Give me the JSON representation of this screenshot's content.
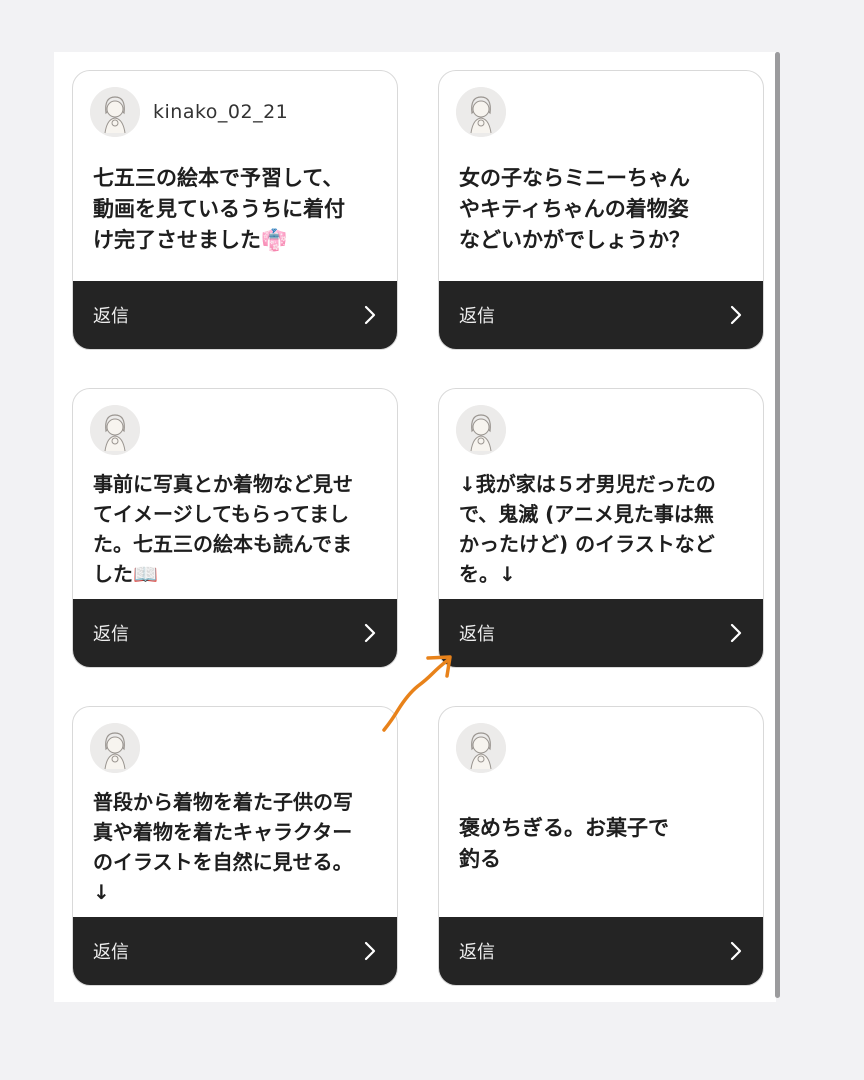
{
  "cards": [
    {
      "username": "kinako_02_21",
      "text": "七五三の絵本で予習して、\n動画を見ているうちに着付\nけ完了させました👘",
      "reply_label": "返信"
    },
    {
      "username": "",
      "text": "女の子ならミニーちゃん\nやキティちゃんの着物姿\nなどいかがでしょうか？",
      "reply_label": "返信"
    },
    {
      "username": "",
      "text": "事前に写真とか着物など見せ\nてイメージしてもらってまし\nた。七五三の絵本も読んでま\nした📖",
      "reply_label": "返信"
    },
    {
      "username": "",
      "text": "↓我が家は５才男児だったの\nで、鬼滅 (アニメ見た事は無\nかったけど) のイラストなど\nを。↓",
      "reply_label": "返信"
    },
    {
      "username": "",
      "text": "普段から着物を着た子供の写\n真や着物を着たキャラクター\nのイラストを自然に見せる。\n↓",
      "reply_label": "返信"
    },
    {
      "username": "",
      "text": "褒めちぎる。お菓子で\n釣る",
      "reply_label": "返信"
    }
  ],
  "icons": {
    "avatar": "girl-illustration-avatar",
    "reply_chevron": "chevron-right-icon",
    "annotation": "orange-curved-arrow"
  },
  "colors": {
    "reply_bar": "#242424",
    "annotation_arrow": "#e8821a"
  }
}
